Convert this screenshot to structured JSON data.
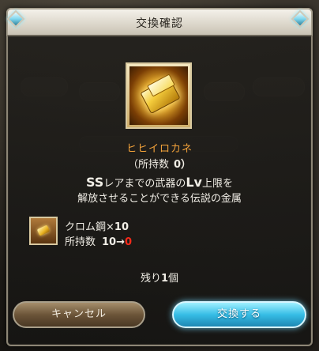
{
  "dialog": {
    "title": "交換確認"
  },
  "item": {
    "icon": "gold-ingot-icon",
    "name": "ヒヒイロカネ",
    "owned_label": "（所持数",
    "owned_count": "0）"
  },
  "description": {
    "line1_prefix": "SS",
    "line1_mid": "レアまでの武器の",
    "line1_lv": "Lv",
    "line1_suffix": "上限を",
    "line2": "解放させることができる伝説の金属"
  },
  "cost": {
    "icon": "chrome-steel-icon",
    "name": "クロム鋼×",
    "quantity": "10",
    "owned_label": "所持数",
    "owned_from": "10→",
    "owned_to": "0"
  },
  "remaining": {
    "label": "残り",
    "count": "1",
    "unit": "個"
  },
  "buttons": {
    "cancel": "キャンセル",
    "confirm": "交換する"
  },
  "colors": {
    "item_name": "#f2a23a",
    "alert_red": "#ff2a1a",
    "confirm_button": "#36bde6",
    "cancel_button": "#6c5539"
  }
}
